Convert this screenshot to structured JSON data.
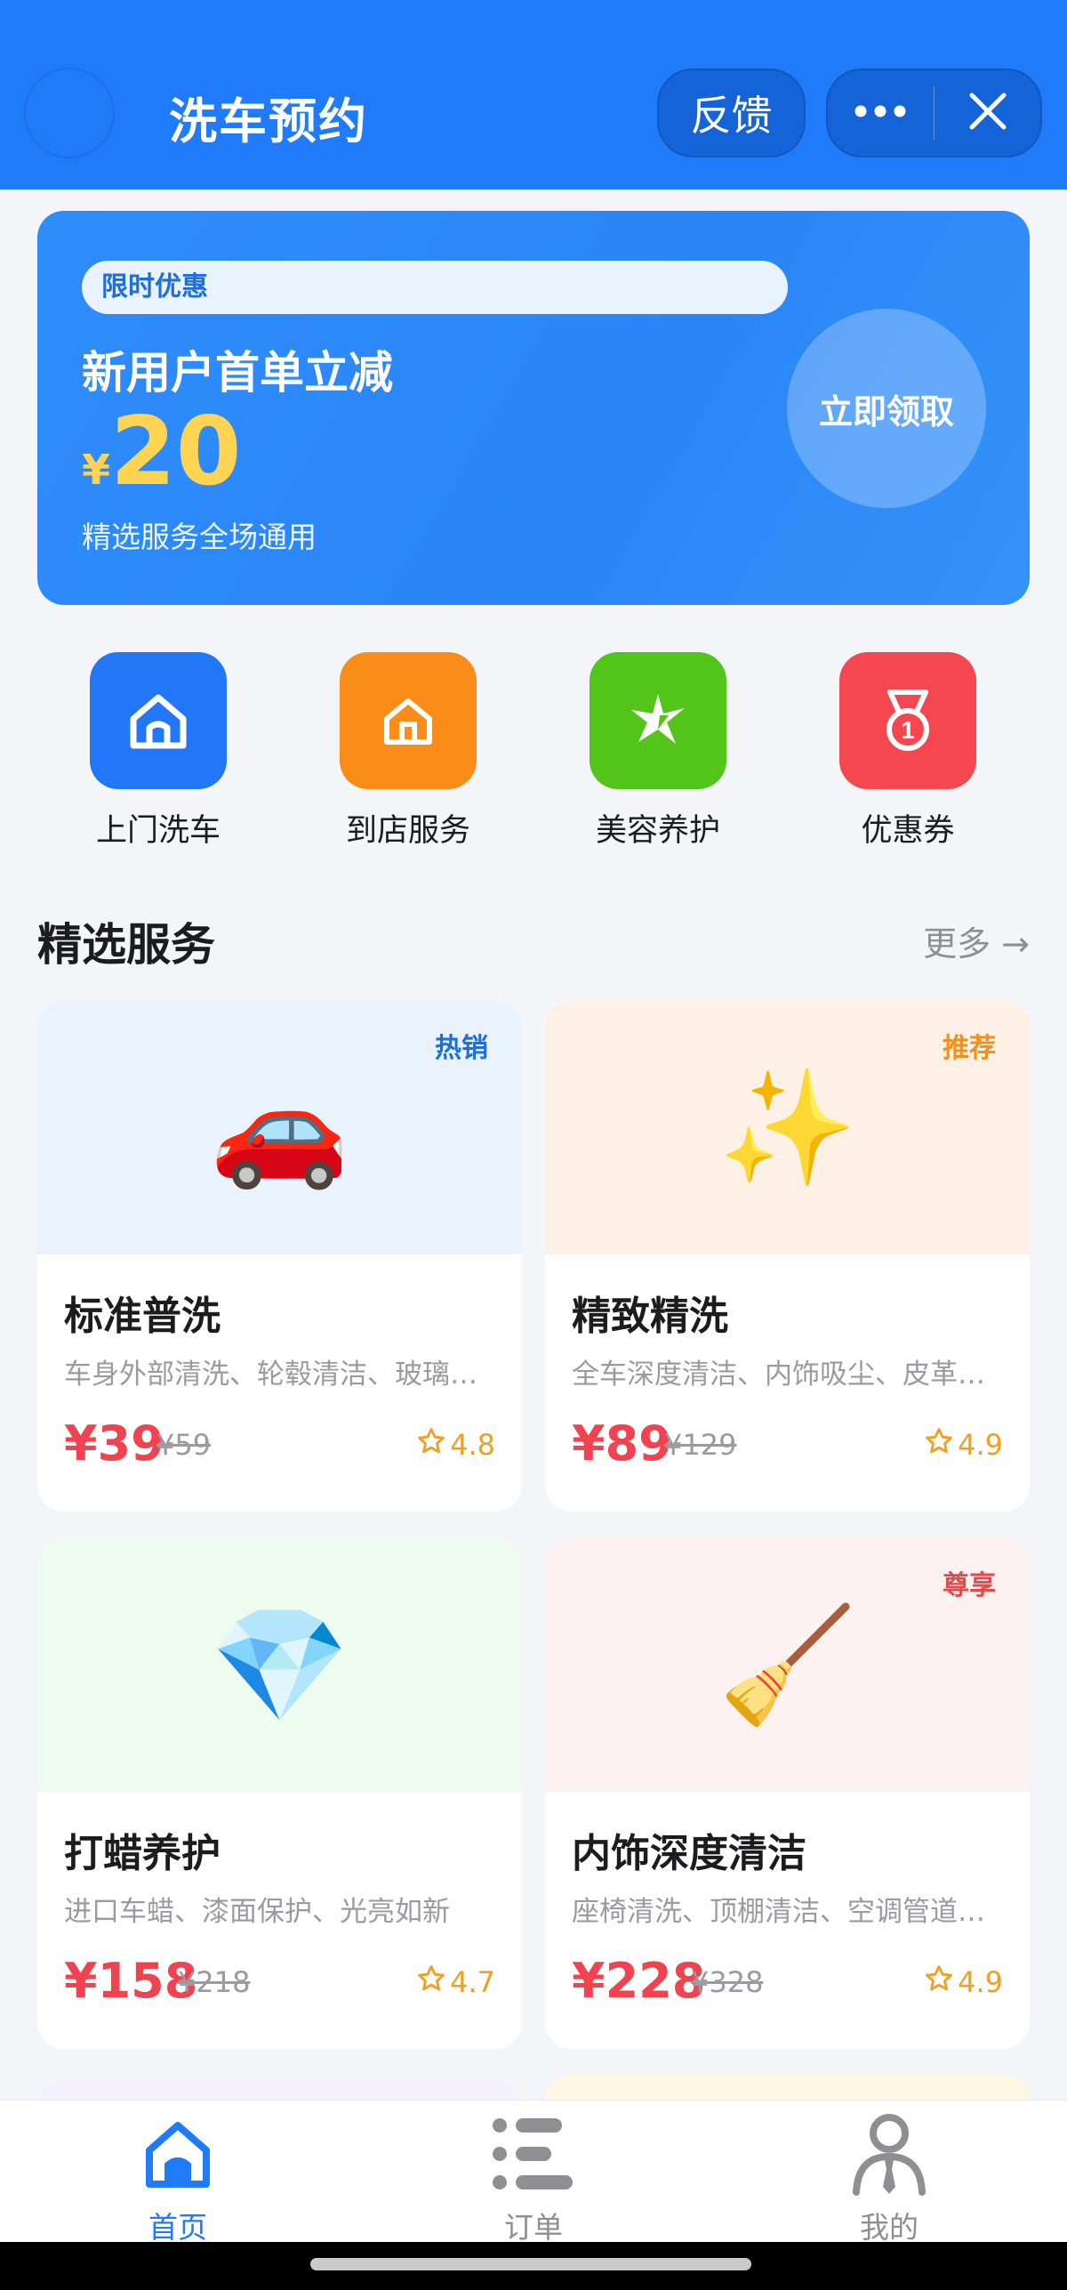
{
  "header": {
    "title": "洗车预约",
    "feedback_label": "反馈",
    "more_icon": "more-dots-icon",
    "close_icon": "close-icon",
    "bg_color": "#1f7bf7"
  },
  "banner": {
    "tag": "限时优惠",
    "title": "新用户首单立减",
    "currency": "¥",
    "amount": "20",
    "desc": "精选服务全场通用",
    "claim_label": "立即领取"
  },
  "categories": [
    {
      "label": "上门洗车",
      "icon": "home-icon",
      "color": "#2277f6"
    },
    {
      "label": "到店服务",
      "icon": "store-icon",
      "color": "#fa8c1a"
    },
    {
      "label": "美容养护",
      "icon": "sparkle-star-icon",
      "color": "#52c41a"
    },
    {
      "label": "优惠券",
      "icon": "medal-icon",
      "color": "#f5474f"
    }
  ],
  "section": {
    "title": "精选服务",
    "more_label": "更多",
    "more_icon": "arrow-right-icon"
  },
  "products": [
    {
      "name": "标准普洗",
      "desc": "车身外部清洗、轮毂清洁、玻璃擦拭",
      "price": "¥39",
      "orig": "¥59",
      "rating": "4.8",
      "badge": "热销",
      "badge_color": "#1d6fe0",
      "emoji": "🚗",
      "bg": "#eaf3fd"
    },
    {
      "name": "精致精洗",
      "desc": "全车深度清洁、内饰吸尘、皮革护理",
      "price": "¥89",
      "orig": "¥129",
      "rating": "4.9",
      "badge": "推荐",
      "badge_color": "#f0901e",
      "emoji": "✨",
      "bg": "#fdf1e6"
    },
    {
      "name": "打蜡养护",
      "desc": "进口车蜡、漆面保护、光亮如新",
      "price": "¥158",
      "orig": "¥218",
      "rating": "4.7",
      "badge": "",
      "badge_color": "#1d6fe0",
      "emoji": "💎",
      "bg": "#eefcef"
    },
    {
      "name": "内饰深度清洁",
      "desc": "座椅清洗、顶棚清洁、空调管道消毒",
      "price": "¥228",
      "orig": "¥328",
      "rating": "4.9",
      "badge": "尊享",
      "badge_color": "#e24b4b",
      "emoji": "🧹",
      "bg": "#fdf1f2"
    }
  ],
  "tabs": [
    {
      "label": "首页",
      "icon": "home-tab-icon",
      "active": true
    },
    {
      "label": "订单",
      "icon": "order-list-icon",
      "active": false
    },
    {
      "label": "我的",
      "icon": "profile-icon",
      "active": false
    }
  ],
  "colors": {
    "primary": "#1f7bf7",
    "price_red": "#f0434f",
    "rating_orange": "#f0a020",
    "accent_yellow": "#ffd452"
  }
}
